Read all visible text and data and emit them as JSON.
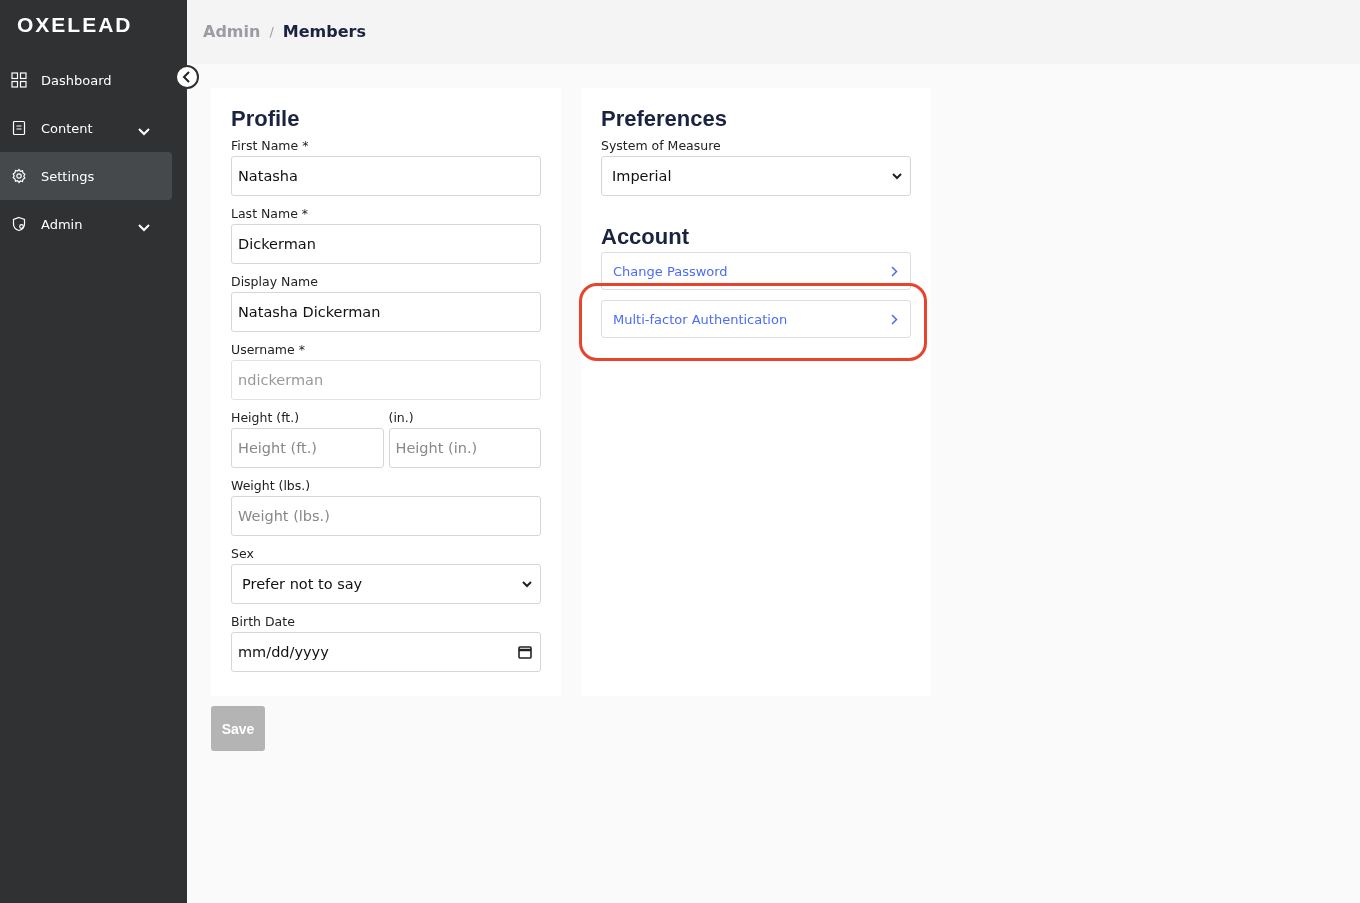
{
  "logo": "OXELEAD",
  "sidebar": {
    "items": [
      {
        "label": "Dashboard",
        "selected": false,
        "expandable": false
      },
      {
        "label": "Content",
        "selected": false,
        "expandable": true
      },
      {
        "label": "Settings",
        "selected": true,
        "expandable": false
      },
      {
        "label": "Admin",
        "selected": false,
        "expandable": true
      }
    ]
  },
  "breadcrumb": {
    "parent": "Admin",
    "separator": "/",
    "current": "Members"
  },
  "profile": {
    "title": "Profile",
    "fields": [
      {
        "kind": "text",
        "label": "First Name *",
        "value": "Natasha",
        "disabled": false
      },
      {
        "kind": "text",
        "label": "Last Name *",
        "value": "Dickerman",
        "disabled": false
      },
      {
        "kind": "text",
        "label": "Display Name",
        "value": "Natasha Dickerman",
        "disabled": false
      },
      {
        "kind": "text",
        "label": "Username *",
        "value": "ndickerman",
        "disabled": true
      },
      {
        "kind": "pair",
        "parts": [
          {
            "label": "Height (ft.)",
            "placeholder": "Height (ft.)"
          },
          {
            "label": "(in.)",
            "placeholder": "Height (in.)"
          }
        ]
      },
      {
        "kind": "text",
        "label": "Weight (lbs.)",
        "placeholder": "Weight (lbs.)",
        "disabled": false
      },
      {
        "kind": "select",
        "label": "Sex",
        "value": "Prefer not to say"
      },
      {
        "kind": "date",
        "label": "Birth Date",
        "value": "mm/dd/yyyy"
      }
    ]
  },
  "preferences": {
    "title": "Preferences",
    "label": "System of Measure",
    "value": "Imperial"
  },
  "account": {
    "title": "Account",
    "links": [
      {
        "label": "Change Password",
        "highlighted": false
      },
      {
        "label": "Multi-factor Authentication",
        "highlighted": true
      }
    ]
  },
  "save_button": {
    "label": "Save",
    "disabled": true
  }
}
